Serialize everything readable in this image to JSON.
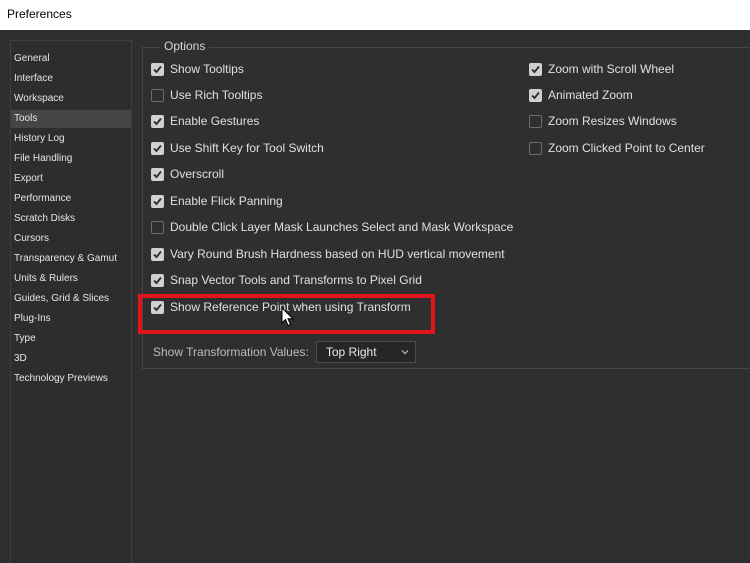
{
  "window": {
    "title": "Preferences"
  },
  "sidebar": {
    "items": [
      {
        "label": "General",
        "selected": false
      },
      {
        "label": "Interface",
        "selected": false
      },
      {
        "label": "Workspace",
        "selected": false
      },
      {
        "label": "Tools",
        "selected": true
      },
      {
        "label": "History Log",
        "selected": false
      },
      {
        "label": "File Handling",
        "selected": false
      },
      {
        "label": "Export",
        "selected": false
      },
      {
        "label": "Performance",
        "selected": false
      },
      {
        "label": "Scratch Disks",
        "selected": false
      },
      {
        "label": "Cursors",
        "selected": false
      },
      {
        "label": "Transparency & Gamut",
        "selected": false
      },
      {
        "label": "Units & Rulers",
        "selected": false
      },
      {
        "label": "Guides, Grid & Slices",
        "selected": false
      },
      {
        "label": "Plug-Ins",
        "selected": false
      },
      {
        "label": "Type",
        "selected": false
      },
      {
        "label": "3D",
        "selected": false
      },
      {
        "label": "Technology Previews",
        "selected": false
      }
    ]
  },
  "options": {
    "legend": "Options",
    "left_column": [
      {
        "label": "Show Tooltips",
        "checked": true
      },
      {
        "label": "Use Rich Tooltips",
        "checked": false
      },
      {
        "label": "Enable Gestures",
        "checked": true
      },
      {
        "label": "Use Shift Key for Tool Switch",
        "checked": true
      },
      {
        "label": "Overscroll",
        "checked": true
      },
      {
        "label": "Enable Flick Panning",
        "checked": true
      },
      {
        "label": "Double Click Layer Mask Launches Select and Mask Workspace",
        "checked": false
      },
      {
        "label": "Vary Round Brush Hardness based on HUD vertical movement",
        "checked": true
      },
      {
        "label": "Snap Vector Tools and Transforms to Pixel Grid",
        "checked": true
      },
      {
        "label": "Show Reference Point when using Transform",
        "checked": true
      }
    ],
    "right_column": [
      {
        "label": "Zoom with Scroll Wheel",
        "checked": true
      },
      {
        "label": "Animated Zoom",
        "checked": true
      },
      {
        "label": "Zoom Resizes Windows",
        "checked": false
      },
      {
        "label": "Zoom Clicked Point to Center",
        "checked": false
      }
    ],
    "transformation_values": {
      "label": "Show Transformation Values:",
      "selected": "Top Right"
    }
  },
  "annotation": {
    "highlight_color": "#e1141b"
  },
  "colors": {
    "panel_bg": "#2f2f2f",
    "selected_nav": "#454545",
    "checkbox_on": "#d0d0d0"
  }
}
